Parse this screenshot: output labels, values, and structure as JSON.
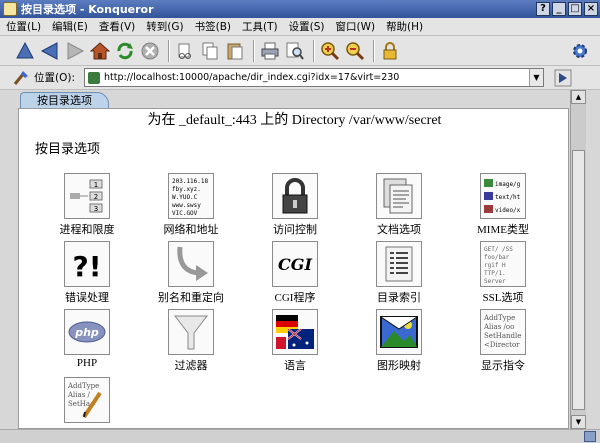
{
  "window": {
    "title": "按目录选项 - Konqueror"
  },
  "menu": [
    "位置(L)",
    "编辑(E)",
    "查看(V)",
    "转到(G)",
    "书签(B)",
    "工具(T)",
    "设置(S)",
    "窗口(W)",
    "帮助(H)"
  ],
  "location": {
    "label": "位置(O):",
    "url": "http://localhost:10000/apache/dir_index.cgi?idx=17&virt=230"
  },
  "tab": {
    "label": "按目录选项"
  },
  "page": {
    "heading": "为在 _default_:443 上的 Directory /var/www/secret",
    "subheading": "按目录选项",
    "items": [
      {
        "label": "进程和限度",
        "icon": "process-limits-icon"
      },
      {
        "label": "网络和地址",
        "icon": "network-address-icon"
      },
      {
        "label": "访问控制",
        "icon": "padlock-icon"
      },
      {
        "label": "文档选项",
        "icon": "document-options-icon"
      },
      {
        "label": "MIME类型",
        "icon": "mime-types-icon"
      },
      {
        "label": "错误处理",
        "icon": "error-handling-icon"
      },
      {
        "label": "别名和重定向",
        "icon": "redirect-arrow-icon"
      },
      {
        "label": "CGI程序",
        "icon": "cgi-icon"
      },
      {
        "label": "目录索引",
        "icon": "directory-index-icon"
      },
      {
        "label": "SSL选项",
        "icon": "ssl-options-icon"
      },
      {
        "label": "PHP",
        "icon": "php-icon"
      },
      {
        "label": "过滤器",
        "icon": "funnel-icon"
      },
      {
        "label": "语言",
        "icon": "flags-icon"
      },
      {
        "label": "图形映射",
        "icon": "image-map-icon"
      },
      {
        "label": "显示指令",
        "icon": "show-directives-icon"
      },
      {
        "label": "",
        "icon": "edit-directives-icon"
      }
    ],
    "icon_text": {
      "network": [
        "203.116.18",
        "fby.xyz.",
        "W.YUO.C",
        "www.swsy",
        "VIC.GOV"
      ],
      "mime": [
        "image/g",
        "text/ht",
        "video/x"
      ],
      "cgi": "CGI",
      "error": "?!",
      "php": "php",
      "ssl": [
        "GET/ /SS",
        "foo/bar",
        "rgif H",
        "TTP/1.",
        "Server"
      ],
      "show": [
        "AddType",
        "Alias /oo",
        "SetHandle",
        "<Director"
      ],
      "edit": [
        "AddType",
        "Alias /",
        "SetHa"
      ],
      "process": [
        "1",
        "2",
        "3"
      ]
    }
  }
}
